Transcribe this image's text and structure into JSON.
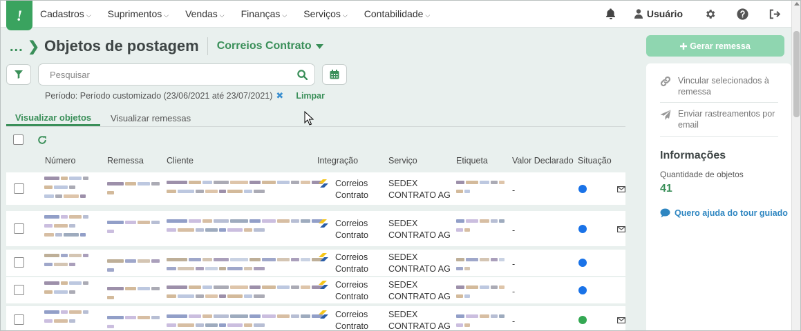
{
  "nav": {
    "menu": [
      {
        "label": "Cadastros"
      },
      {
        "label": "Suprimentos"
      },
      {
        "label": "Vendas"
      },
      {
        "label": "Finanças"
      },
      {
        "label": "Serviços"
      },
      {
        "label": "Contabilidade"
      }
    ],
    "user_label": "Usuário"
  },
  "header": {
    "breadcrumb_ellipsis": "...",
    "title": "Objetos de postagem",
    "contract_label": "Correios Contrato"
  },
  "search": {
    "placeholder": "Pesquisar"
  },
  "filter": {
    "period_text": "Período: Período customizado (23/06/2021 até 23/07/2021)",
    "clear_label": "Limpar"
  },
  "tabs": [
    {
      "label": "Visualizar objetos"
    },
    {
      "label": "Visualizar remessas"
    }
  ],
  "table": {
    "columns": [
      "Número",
      "Remessa",
      "Cliente",
      "Integração",
      "Serviço",
      "Etiqueta",
      "Valor Declarado",
      "Situação"
    ],
    "rows": [
      {
        "integration": [
          "Correios",
          "Contrato"
        ],
        "service": [
          "SEDEX",
          "CONTRATO AG"
        ],
        "value": "-",
        "status_color": "#1a73e8",
        "has_mail": true
      },
      {
        "integration": [
          "Correios",
          "Contrato"
        ],
        "service": [
          "SEDEX",
          "CONTRATO AG"
        ],
        "value": "-",
        "status_color": "#1a73e8",
        "has_mail": true
      },
      {
        "integration": [
          "Correios",
          "Contrato"
        ],
        "service": [
          "SEDEX",
          "CONTRATO AG"
        ],
        "value": "-",
        "status_color": "#1a73e8",
        "has_mail": false
      },
      {
        "integration": [
          "Correios",
          "Contrato"
        ],
        "service": [
          "SEDEX",
          "CONTRATO AG"
        ],
        "value": "-",
        "status_color": "#1a73e8",
        "has_mail": false
      },
      {
        "integration": [
          "Correios",
          "Contrato"
        ],
        "service": [
          "SEDEX",
          "CONTRATO AG"
        ],
        "value": "-",
        "status_color": "#34a853",
        "has_mail": true
      }
    ]
  },
  "sidebar": {
    "create_button": "Gerar remessa",
    "actions": [
      {
        "label": "Vincular selecionados à remessa",
        "icon": "link-icon"
      },
      {
        "label": "Enviar rastreamentos por email",
        "icon": "send-icon"
      }
    ],
    "info_title": "Informações",
    "count_label": "Quantidade de objetos",
    "count_value": "41",
    "help_label": "Quero ajuda do tour guiado"
  },
  "colors": {
    "brand_green": "#3aa35f",
    "accent_green": "#3a8f59",
    "button_disabled_green": "#8fd6b0",
    "link_blue": "#2e86c1"
  }
}
